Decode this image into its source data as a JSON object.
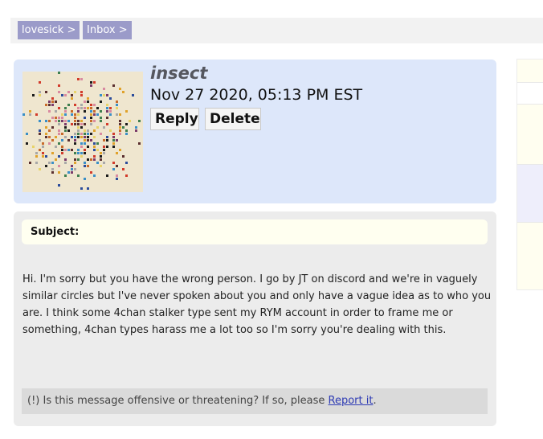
{
  "breadcrumbs": [
    {
      "label": "lovesick >"
    },
    {
      "label": "Inbox >"
    }
  ],
  "message": {
    "sender": "insect",
    "date": "Nov 27 2020, 05:13 PM EST",
    "actions": {
      "reply_label": "Reply",
      "delete_label": "Delete"
    },
    "subject_label": "Subject:",
    "subject_value": "",
    "body": "Hi. I'm sorry but you have the wrong person. I go by JT on discord and we're in vaguely similar circles but I've never spoken about you and only have a vague idea as to who you are. I think some 4chan stalker type sent my RYM account in order to frame me or something, 4chan types harass me a lot too so I'm sorry you're dealing with this."
  },
  "report": {
    "prefix": "(!) Is this message offensive or threatening? If so, please ",
    "link_label": "Report it",
    "suffix": "."
  },
  "colors": {
    "breadcrumb_bg": "#9b9bc9",
    "header_bg": "#dde7fa",
    "message_bg": "#ececec",
    "subject_bg": "#fffff0",
    "report_bg": "#dadada",
    "link": "#2e3bb4"
  },
  "avatar": {
    "description_icon": "pixel-mosaic-avatar"
  }
}
